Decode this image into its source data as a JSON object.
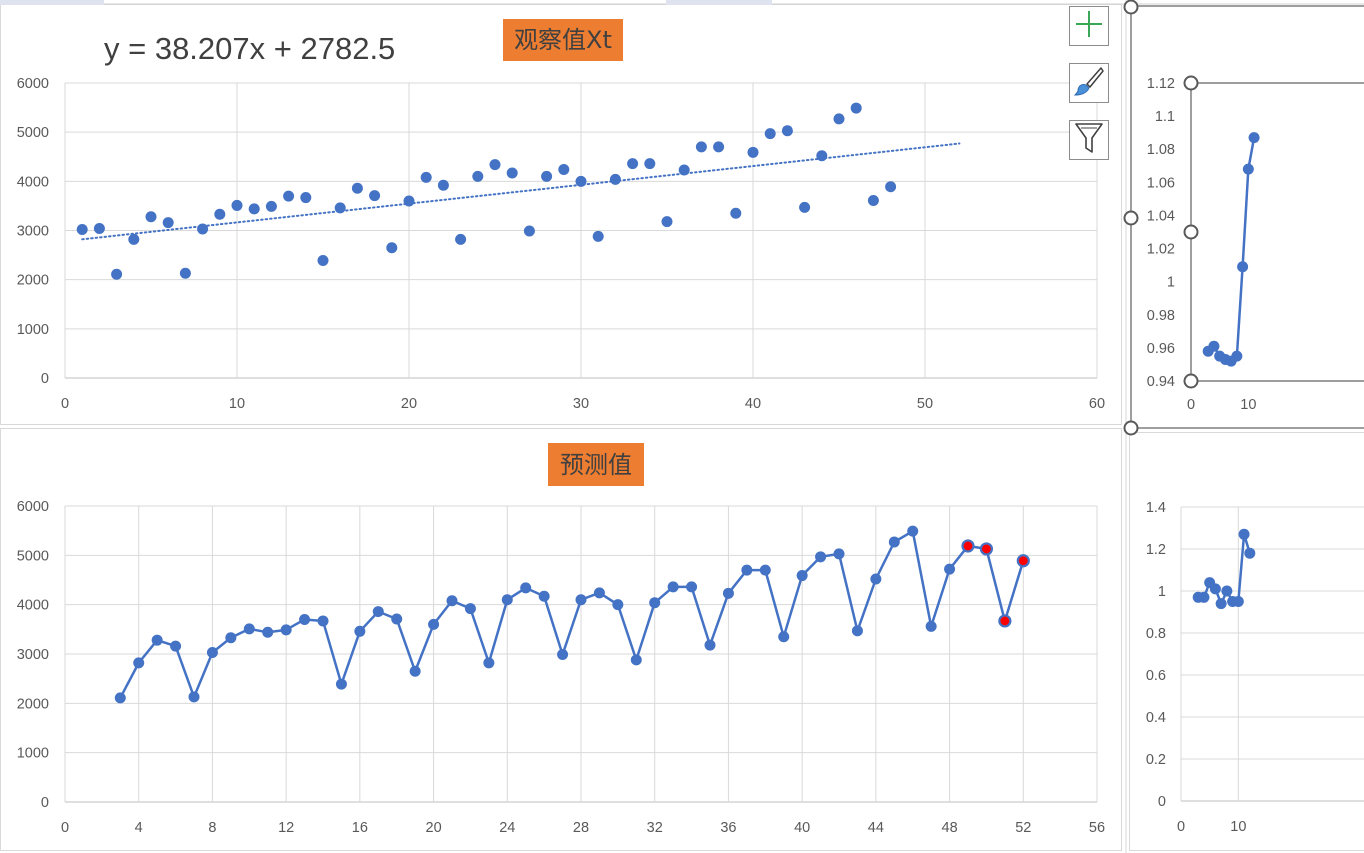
{
  "toolbar": {
    "elements_icon": "plus-icon",
    "styles_icon": "brush-icon",
    "filter_icon": "filter-icon"
  },
  "colors": {
    "series": "#4472C4",
    "title_box": "#ED7D31",
    "marker_red": "#FF0000",
    "grid": "#D9D9D9"
  },
  "chart_data": [
    {
      "id": "observed",
      "type": "scatter",
      "title": "观察值Xt",
      "trendline_equation": "y = 38.207x + 2782.5",
      "trendline": {
        "type": "linear",
        "slope": 38.207,
        "intercept": 2782.5,
        "x_range": [
          1,
          52
        ],
        "style": "dotted"
      },
      "xlim": [
        0,
        60
      ],
      "ylim": [
        0,
        6000
      ],
      "xticks": [
        0,
        10,
        20,
        30,
        40,
        50,
        60
      ],
      "yticks": [
        0,
        1000,
        2000,
        3000,
        4000,
        5000,
        6000
      ],
      "grid": true,
      "points": [
        [
          1,
          3020
        ],
        [
          2,
          3040
        ],
        [
          3,
          2110
        ],
        [
          4,
          2820
        ],
        [
          5,
          3280
        ],
        [
          6,
          3160
        ],
        [
          7,
          2130
        ],
        [
          8,
          3030
        ],
        [
          9,
          3330
        ],
        [
          10,
          3510
        ],
        [
          11,
          3440
        ],
        [
          12,
          3490
        ],
        [
          13,
          3700
        ],
        [
          14,
          3670
        ],
        [
          15,
          2390
        ],
        [
          16,
          3460
        ],
        [
          17,
          3860
        ],
        [
          18,
          3710
        ],
        [
          19,
          2650
        ],
        [
          20,
          3600
        ],
        [
          21,
          4080
        ],
        [
          22,
          3920
        ],
        [
          23,
          2820
        ],
        [
          24,
          4100
        ],
        [
          25,
          4340
        ],
        [
          26,
          4170
        ],
        [
          27,
          2990
        ],
        [
          28,
          4100
        ],
        [
          29,
          4240
        ],
        [
          30,
          4000
        ],
        [
          31,
          2880
        ],
        [
          32,
          4040
        ],
        [
          33,
          4360
        ],
        [
          34,
          4360
        ],
        [
          35,
          3180
        ],
        [
          36,
          4230
        ],
        [
          37,
          4700
        ],
        [
          38,
          4700
        ],
        [
          39,
          3350
        ],
        [
          40,
          4590
        ],
        [
          41,
          4970
        ],
        [
          42,
          5030
        ],
        [
          43,
          3470
        ],
        [
          44,
          4520
        ],
        [
          45,
          5270
        ],
        [
          46,
          5490
        ],
        [
          47,
          3610
        ],
        [
          48,
          3890
        ]
      ]
    },
    {
      "id": "ratio-top",
      "type": "line",
      "title": "",
      "xlim": [
        0,
        60
      ],
      "ylim": [
        0.94,
        1.12
      ],
      "xticks": [
        0,
        10
      ],
      "yticks": [
        0.94,
        0.96,
        0.98,
        1,
        1.02,
        1.04,
        1.06,
        1.08,
        1.1,
        1.12
      ],
      "ytick_labels": [
        "0.94",
        "0.96",
        "0.98",
        "1",
        "1.02",
        "1.04",
        "1.06",
        "1.08",
        "1.1",
        "1.12"
      ],
      "grid": false,
      "points": [
        [
          3,
          0.958
        ],
        [
          4,
          0.961
        ],
        [
          5,
          0.955
        ],
        [
          6,
          0.953
        ],
        [
          7,
          0.952
        ],
        [
          8,
          0.955
        ],
        [
          9,
          1.009
        ],
        [
          10,
          1.068
        ],
        [
          11,
          1.087
        ]
      ]
    },
    {
      "id": "forecast",
      "type": "line",
      "title": "预测值",
      "xlim": [
        0,
        56
      ],
      "ylim": [
        0,
        6000
      ],
      "xticks": [
        0,
        4,
        8,
        12,
        16,
        20,
        24,
        28,
        32,
        36,
        40,
        44,
        48,
        52,
        56
      ],
      "yticks": [
        0,
        1000,
        2000,
        3000,
        4000,
        5000,
        6000
      ],
      "grid": true,
      "points": [
        [
          3,
          2110
        ],
        [
          4,
          2820
        ],
        [
          5,
          3280
        ],
        [
          6,
          3160
        ],
        [
          7,
          2130
        ],
        [
          8,
          3030
        ],
        [
          9,
          3330
        ],
        [
          10,
          3510
        ],
        [
          11,
          3440
        ],
        [
          12,
          3490
        ],
        [
          13,
          3700
        ],
        [
          14,
          3670
        ],
        [
          15,
          2390
        ],
        [
          16,
          3460
        ],
        [
          17,
          3860
        ],
        [
          18,
          3710
        ],
        [
          19,
          2650
        ],
        [
          20,
          3600
        ],
        [
          21,
          4080
        ],
        [
          22,
          3920
        ],
        [
          23,
          2820
        ],
        [
          24,
          4100
        ],
        [
          25,
          4340
        ],
        [
          26,
          4170
        ],
        [
          27,
          2990
        ],
        [
          28,
          4100
        ],
        [
          29,
          4240
        ],
        [
          30,
          4000
        ],
        [
          31,
          2880
        ],
        [
          32,
          4040
        ],
        [
          33,
          4360
        ],
        [
          34,
          4360
        ],
        [
          35,
          3180
        ],
        [
          36,
          4230
        ],
        [
          37,
          4700
        ],
        [
          38,
          4700
        ],
        [
          39,
          3350
        ],
        [
          40,
          4590
        ],
        [
          41,
          4970
        ],
        [
          42,
          5030
        ],
        [
          43,
          3470
        ],
        [
          44,
          4520
        ],
        [
          45,
          5270
        ],
        [
          46,
          5490
        ],
        [
          47,
          3560
        ],
        [
          48,
          4720
        ],
        [
          49,
          5190
        ],
        [
          50,
          5130
        ],
        [
          51,
          3670
        ],
        [
          52,
          4890
        ]
      ],
      "highlighted_x": [
        49,
        50,
        51,
        52
      ]
    },
    {
      "id": "ratio-bottom",
      "type": "line",
      "title": "",
      "xlim": [
        0,
        60
      ],
      "ylim": [
        0,
        1.4
      ],
      "xticks": [
        0,
        10
      ],
      "yticks": [
        0,
        0.2,
        0.4,
        0.6,
        0.8,
        1,
        1.2,
        1.4
      ],
      "ytick_labels": [
        "0",
        "0.2",
        "0.4",
        "0.6",
        "0.8",
        "1",
        "1.2",
        "1.4"
      ],
      "grid": true,
      "points": [
        [
          3,
          0.97
        ],
        [
          4,
          0.97
        ],
        [
          5,
          1.04
        ],
        [
          6,
          1.01
        ],
        [
          7,
          0.94
        ],
        [
          8,
          1.0
        ],
        [
          9,
          0.95
        ],
        [
          10,
          0.95
        ],
        [
          11,
          1.27
        ],
        [
          12,
          1.18
        ]
      ]
    }
  ]
}
